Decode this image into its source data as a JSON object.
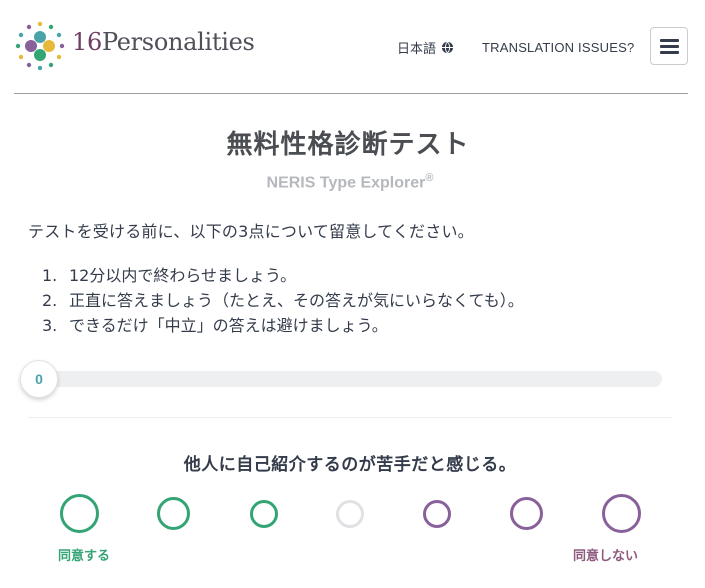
{
  "header": {
    "logo_number": "16",
    "logo_word": "Personalities",
    "language_label": "日本語",
    "language_icon": "globe-icon",
    "translation_link": "TRANSLATION ISSUES?",
    "menu_icon": "hamburger-menu-icon"
  },
  "main": {
    "title": "無料性格診断テスト",
    "subtitle": "NERIS Type Explorer",
    "subtitle_mark": "®",
    "intro": "テストを受ける前に、以下の3点について留意してください。",
    "rules": [
      {
        "num": "1.",
        "text": "12分以内で終わらせましょう。"
      },
      {
        "num": "2.",
        "text": "正直に答えましょう（たとえ、その答えが気にいらなくても）。"
      },
      {
        "num": "3.",
        "text": "できるだけ「中立」の答えは避けましょう。"
      }
    ]
  },
  "progress": {
    "label": "0",
    "percent": 0
  },
  "question": {
    "text": "他人に自己紹介するのが苦手だと感じる。",
    "agree_label": "同意する",
    "disagree_label": "同意しない",
    "option_count": 7
  },
  "colors": {
    "agree": "#33a474",
    "disagree": "#88619a",
    "neutral": "#dfe1e4",
    "progress_text": "#4aa3a8",
    "logo_accent": "#6f3f63"
  }
}
